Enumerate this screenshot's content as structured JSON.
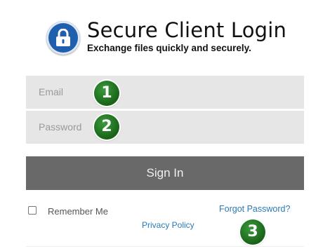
{
  "header": {
    "icon": "lock-icon",
    "title": "Secure Client Login",
    "subtitle": "Exchange files quickly and securely."
  },
  "form": {
    "email": {
      "placeholder": "Email",
      "value": ""
    },
    "password": {
      "placeholder": "Password",
      "value": ""
    },
    "sign_in_label": "Sign In",
    "remember_me_label": "Remember Me",
    "remember_me_checked": false,
    "forgot_password_label": "Forgot Password?",
    "privacy_policy_label": "Privacy Policy"
  },
  "annotations": {
    "step1": "1",
    "step2": "2",
    "step3": "3"
  },
  "colors": {
    "accent": "#1f5fae",
    "field_bg": "#e6e6e6",
    "button_bg": "#696969",
    "link": "#2a7ab8",
    "step_badge": "#1d6b1d"
  }
}
